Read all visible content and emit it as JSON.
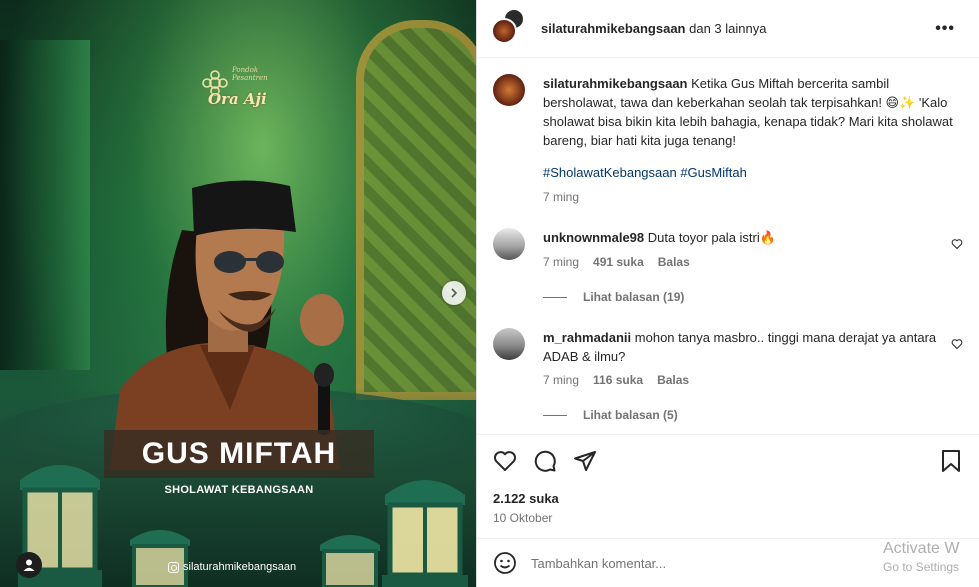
{
  "media": {
    "logo_top": "Pondok Pesantren",
    "logo_name": "Ora Aji",
    "title": "GUS MIFTAH",
    "subtitle": "SHOLAWAT KEBANGSAAN",
    "handle": "silaturahmikebangsaan"
  },
  "header": {
    "username": "silaturahmikebangsaan",
    "rest": "dan 3 lainnya",
    "more": "•••"
  },
  "caption": {
    "username": "silaturahmikebangsaan",
    "text": "Ketika Gus Miftah bercerita sambil bersholawat, tawa dan keberkahan seolah tak terpisahkan! 😄✨ 'Kalo sholawat bisa bikin kita lebih bahagia, kenapa tidak? Mari kita sholawat bareng, biar hati kita juga tenang!",
    "hashtags": "#SholawatKebangsaan #GusMiftah",
    "time": "7 ming"
  },
  "comments": [
    {
      "username": "unknownmale98",
      "text": "Duta toyor pala istri🔥",
      "time": "7 ming",
      "likes": "491 suka",
      "reply": "Balas",
      "view_replies": "Lihat balasan (19)"
    },
    {
      "username": "m_rahmadanii",
      "text": "mohon tanya masbro.. tinggi mana derajat ya antara ADAB & ilmu?",
      "time": "7 ming",
      "likes": "116 suka",
      "reply": "Balas",
      "view_replies": "Lihat balasan (5)"
    }
  ],
  "actions": {
    "likes": "2.122 suka",
    "date": "10 Oktober"
  },
  "add_comment": {
    "placeholder": "Tambahkan komentar..."
  },
  "watermark": {
    "line1": "Activate W",
    "line2": "Go to Settings"
  },
  "icons": [
    "heart-icon",
    "comment-icon",
    "share-icon",
    "bookmark-icon",
    "emoji-icon",
    "chevron-right-icon",
    "user-icon",
    "more-icon"
  ]
}
